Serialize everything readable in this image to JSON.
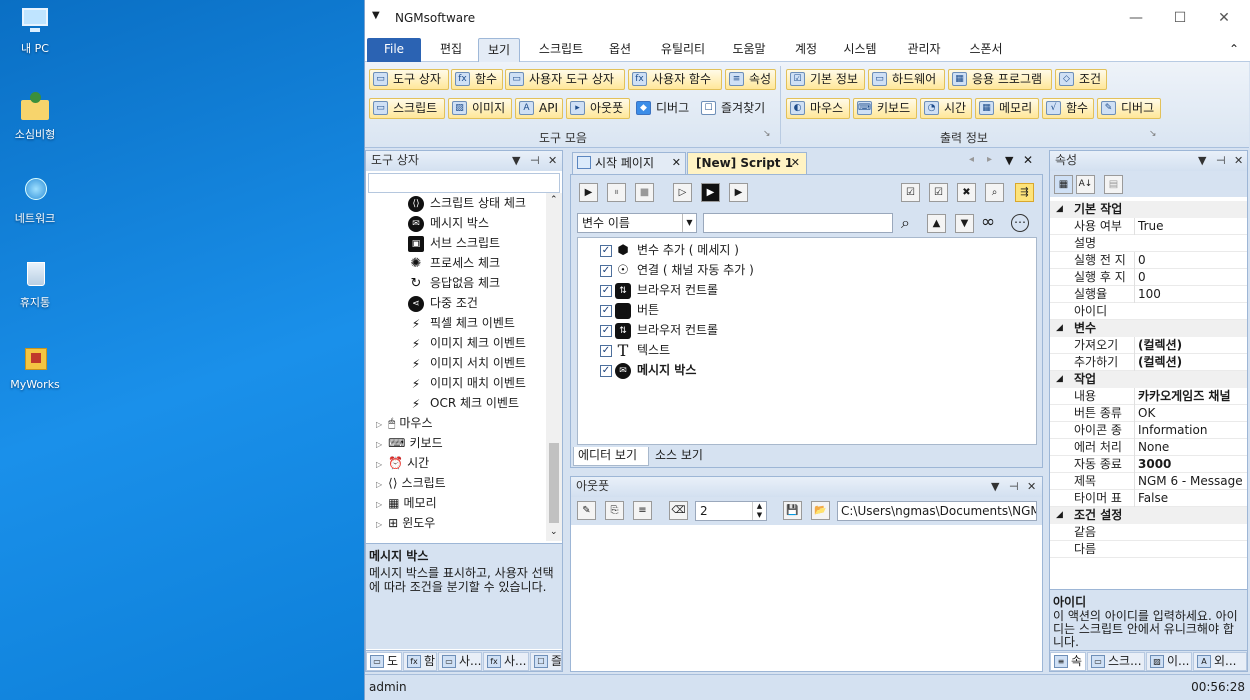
{
  "desktop": {
    "icons": [
      {
        "label": "내 PC"
      },
      {
        "label": "소심비형"
      },
      {
        "label": "네트워크"
      },
      {
        "label": "휴지통"
      },
      {
        "label": "MyWorks"
      }
    ]
  },
  "window": {
    "title": "NGMsoftware",
    "qa_glyph": "▼",
    "minimize": "—",
    "maximize": "☐",
    "close": "✕"
  },
  "menu": {
    "file": "File",
    "items": [
      "편집",
      "보기",
      "스크립트",
      "옵션",
      "유틸리티",
      "도움말",
      "계정",
      "시스템",
      "관리자",
      "스폰서"
    ],
    "collapse": "⌃"
  },
  "ribbon": {
    "group1": {
      "label": "도구 모음",
      "row1": [
        "도구 상자",
        "함수",
        "사용자 도구 상자",
        "사용자 함수",
        "속성"
      ],
      "row2": [
        "스크립트",
        "이미지",
        "API",
        "아웃풋",
        "디버그",
        "즐겨찾기"
      ]
    },
    "group2": {
      "label": "출력 정보",
      "row1": [
        "기본 정보",
        "하드웨어",
        "응용 프로그램",
        "조건"
      ],
      "row2": [
        "마우스",
        "키보드",
        "시간",
        "메모리",
        "함수",
        "디버그"
      ]
    },
    "launcher": "↘"
  },
  "toolbox": {
    "title": "도구 상자",
    "header_glyphs": [
      "▼",
      "⊣",
      "✕"
    ],
    "items": [
      {
        "label": "스크립트 상태 체크",
        "icon": "⟨⟩"
      },
      {
        "label": "메시지 박스",
        "icon": "✉"
      },
      {
        "label": "서브 스크립트",
        "icon": "▣"
      },
      {
        "label": "프로세스 체크",
        "icon": "✺"
      },
      {
        "label": "응답없음 체크",
        "icon": "↻"
      },
      {
        "label": "다중 조건",
        "icon": "⋖"
      },
      {
        "label": "픽셀 체크 이벤트",
        "icon": "⚡"
      },
      {
        "label": "이미지 체크 이벤트",
        "icon": "⚡"
      },
      {
        "label": "이미지 서치 이벤트",
        "icon": "⚡"
      },
      {
        "label": "이미지 매치 이벤트",
        "icon": "⚡"
      },
      {
        "label": "OCR 체크 이벤트",
        "icon": "⚡"
      }
    ],
    "categories": [
      "마우스",
      "키보드",
      "시간",
      "스크립트",
      "메모리",
      "윈도우"
    ],
    "category_icons": [
      "🖱",
      "⌨",
      "⏰",
      "⟨⟩",
      "▦",
      "⊞"
    ],
    "desc_title": "메시지 박스",
    "desc_text": "메시지 박스를 표시하고, 사용자 선택에 따라 조건을 분기할 수 있습니다.",
    "bottom_tabs": [
      "도",
      "함",
      "사...",
      "사...",
      "즐"
    ]
  },
  "editor": {
    "tabs": [
      {
        "label": "시작 페이지"
      },
      {
        "label": "[New] Script 1"
      }
    ],
    "tab_close": "✕",
    "nav_glyphs": [
      "◂",
      "▸",
      "▼",
      "✕"
    ],
    "toolbar_glyphs": [
      "▶",
      "⏸",
      "■",
      "▷",
      "▶",
      "▶"
    ],
    "right_glyphs": [
      "☑",
      "☑",
      "✖",
      "⌕",
      "⇶"
    ],
    "variable_select": "변수 이름",
    "search_value": "",
    "search_glyphs": [
      "⌕",
      "▲",
      "▼",
      "∞",
      "⋯"
    ],
    "rows": [
      {
        "label": "변수 추가 ( 메세지 )",
        "icon": "⬢",
        "bold": false
      },
      {
        "label": "연결 ( 채널 자동 추가 )",
        "icon": "☉",
        "bold": false
      },
      {
        "label": "브라우저 컨트롤",
        "icon": "⇅",
        "bold": false
      },
      {
        "label": "버튼",
        "icon": "■",
        "bold": false
      },
      {
        "label": "브라우저 컨트롤",
        "icon": "⇅",
        "bold": false
      },
      {
        "label": "텍스트",
        "icon": "T",
        "bold": false
      },
      {
        "label": "메시지 박스",
        "icon": "✉",
        "bold": true
      }
    ],
    "view_tabs": [
      "에디터 보기",
      "소스 보기"
    ],
    "check_glyph": "✓"
  },
  "output": {
    "title": "아웃풋",
    "header_glyphs": [
      "▼",
      "⊣",
      "✕"
    ],
    "toolbar_glyphs": [
      "✎",
      "⎘",
      "≡",
      "⌫"
    ],
    "spin_value": "2",
    "file_glyphs": [
      "💾",
      "📂"
    ],
    "path": "C:\\Users\\ngmas\\Documents\\NGM6\\"
  },
  "properties": {
    "title": "속성",
    "header_glyphs": [
      "▼",
      "⊣",
      "✕"
    ],
    "toolbar_glyphs": [
      "▦",
      "A↓",
      "▤"
    ],
    "expand_glyph": "◢",
    "rows": [
      {
        "type": "cat",
        "label": "기본 작업"
      },
      {
        "type": "row",
        "key": "사용 여부",
        "value": "True",
        "bold": false
      },
      {
        "type": "row",
        "key": "설명",
        "value": "",
        "bold": false
      },
      {
        "type": "row",
        "key": "실행 전 지",
        "value": "0",
        "bold": false
      },
      {
        "type": "row",
        "key": "실행 후 지",
        "value": "0",
        "bold": false
      },
      {
        "type": "row",
        "key": "실행율",
        "value": "100",
        "bold": false
      },
      {
        "type": "row",
        "key": "아이디",
        "value": "",
        "bold": false
      },
      {
        "type": "cat",
        "label": "변수"
      },
      {
        "type": "row",
        "key": "가져오기",
        "value": "(컬렉션)",
        "bold": true
      },
      {
        "type": "row",
        "key": "추가하기",
        "value": "(컬렉션)",
        "bold": true
      },
      {
        "type": "cat",
        "label": "작업"
      },
      {
        "type": "row",
        "key": "내용",
        "value": "카카오게임즈 채널",
        "bold": true
      },
      {
        "type": "row",
        "key": "버튼 종류",
        "value": "OK",
        "bold": false
      },
      {
        "type": "row",
        "key": "아이콘 종",
        "value": "Information",
        "bold": false
      },
      {
        "type": "row",
        "key": "에러 처리",
        "value": "None",
        "bold": false
      },
      {
        "type": "row",
        "key": "자동 종료",
        "value": "3000",
        "bold": true
      },
      {
        "type": "row",
        "key": "제목",
        "value": "NGM 6 - Message",
        "bold": false
      },
      {
        "type": "row",
        "key": "타이머 표",
        "value": "False",
        "bold": false
      },
      {
        "type": "cat",
        "label": "조건 설정"
      },
      {
        "type": "row",
        "key": "같음",
        "value": "",
        "bold": false
      },
      {
        "type": "row",
        "key": "다름",
        "value": "",
        "bold": false
      }
    ],
    "desc_title": "아이디",
    "desc_text": "이 액션의 아이디를 입력하세요. 아이디는 스크립트 안에서 유니크해야 합니다.",
    "bottom_tabs": [
      "속",
      "스크...",
      "이...",
      "외..."
    ]
  },
  "status": {
    "user": "admin",
    "time": "00:56:28"
  }
}
